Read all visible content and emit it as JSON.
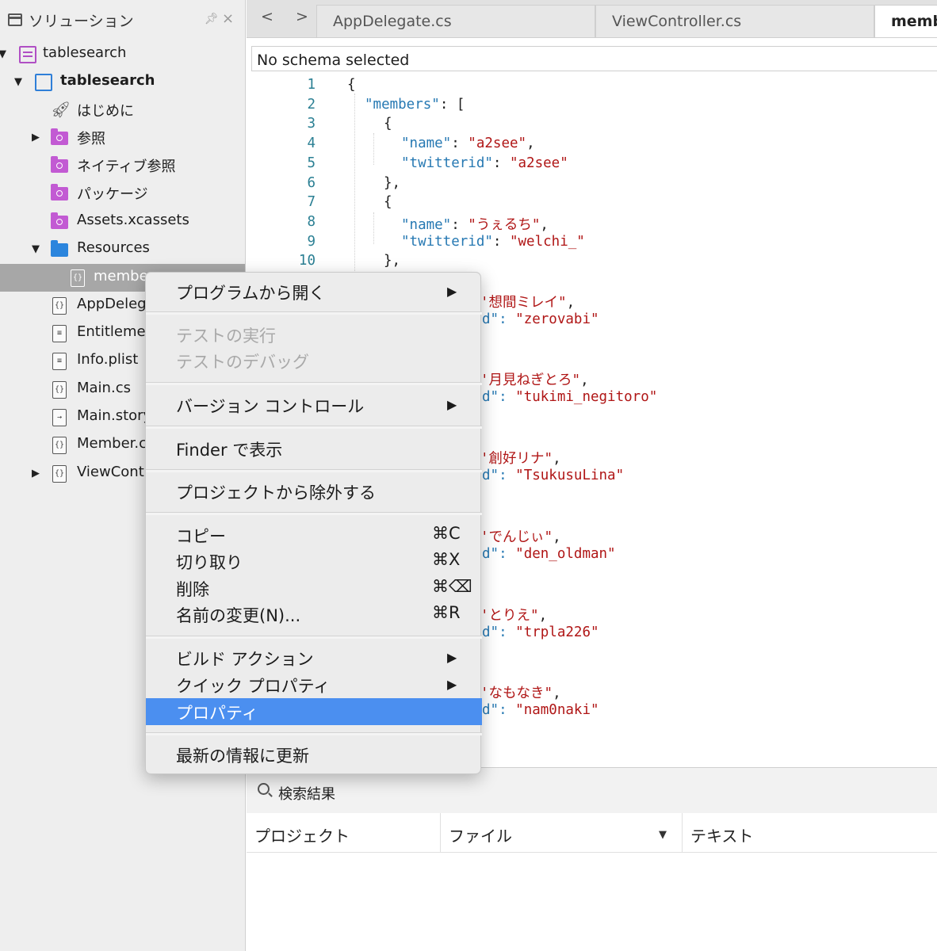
{
  "sidebar": {
    "title": "ソリューション",
    "pin_icon": "pin-icon",
    "close_icon": "close-icon",
    "items": [
      {
        "label": "tablesearch",
        "icon": "solution-icon"
      },
      {
        "label": "tablesearch",
        "icon": "project-icon"
      },
      {
        "label": "はじめに",
        "icon": "rocket-icon"
      },
      {
        "label": "参照",
        "icon": "references-folder-icon"
      },
      {
        "label": "ネイティブ参照",
        "icon": "native-references-folder-icon"
      },
      {
        "label": "パッケージ",
        "icon": "packages-folder-icon"
      },
      {
        "label": "Assets.xcassets",
        "icon": "assets-folder-icon"
      },
      {
        "label": "Resources",
        "icon": "folder-icon"
      },
      {
        "label": "membe",
        "icon": "json-file-icon"
      },
      {
        "label": "AppDeleg",
        "icon": "cs-file-icon"
      },
      {
        "label": "Entitlemer",
        "icon": "plist-file-icon"
      },
      {
        "label": "Info.plist",
        "icon": "plist-file-icon"
      },
      {
        "label": "Main.cs",
        "icon": "cs-file-icon"
      },
      {
        "label": "Main.story",
        "icon": "storyboard-file-icon"
      },
      {
        "label": "Member.c",
        "icon": "cs-file-icon"
      },
      {
        "label": "ViewContr",
        "icon": "cs-file-icon"
      }
    ]
  },
  "editor": {
    "nav_back": "<",
    "nav_forward": ">",
    "tabs": [
      {
        "label": "AppDelegate.cs",
        "active": false
      },
      {
        "label": "ViewController.cs",
        "active": false
      },
      {
        "label": "memb",
        "active": true
      }
    ],
    "schema": "No schema selected",
    "line_numbers": [
      "1",
      "2",
      "3",
      "4",
      "5",
      "6",
      "7",
      "8",
      "9",
      "10"
    ],
    "lines": [
      {
        "text": "{"
      },
      {
        "key": "\"members\"",
        "rest": ": ["
      },
      {
        "text": "{"
      },
      {
        "key": "\"name\"",
        "sep": ": ",
        "str": "\"a2see\"",
        "end": ","
      },
      {
        "key": "\"twitterid\"",
        "sep": ": ",
        "str": "\"a2see\""
      },
      {
        "text": "},"
      },
      {
        "text": "{"
      },
      {
        "key": "\"name\"",
        "sep": ": ",
        "str": "\"うぇるち\"",
        "end": ","
      },
      {
        "key": "\"twitterid\"",
        "sep": ": ",
        "str": "\"welchi_\""
      },
      {
        "text": "},"
      }
    ],
    "hidden_fragments": [
      {
        "prefix": "",
        "str": "'想間ミレイ\"",
        "end": ","
      },
      {
        "prefix": "d\": ",
        "str": "\"zerovabi\""
      },
      {
        "prefix": "",
        "str": "'月見ねぎとろ\"",
        "end": ","
      },
      {
        "prefix": "d\": ",
        "str": "\"tukimi_negitoro\""
      },
      {
        "prefix": "",
        "str": "'創好リナ\"",
        "end": ","
      },
      {
        "prefix": "d\": ",
        "str": "\"TsukusuLina\""
      },
      {
        "prefix": "",
        "str": "'でんじぃ\"",
        "end": ","
      },
      {
        "prefix": "d\": ",
        "str": "\"den_oldman\""
      },
      {
        "prefix": "",
        "str": "'とりえ\"",
        "end": ","
      },
      {
        "prefix": "d\": ",
        "str": "\"trpla226\""
      },
      {
        "prefix": "",
        "str": "'なもなき\"",
        "end": ","
      },
      {
        "prefix": "d\": ",
        "str": "\"nam0naki\""
      }
    ]
  },
  "results": {
    "title": "検索結果",
    "icon": "search-icon",
    "columns": [
      "プロジェクト",
      "ファイル",
      "テキスト"
    ],
    "sort_icon": "▼"
  },
  "context_menu": {
    "items": [
      {
        "label": "プログラムから開く",
        "submenu": true,
        "enabled": true
      },
      {
        "label": "テストの実行",
        "enabled": false
      },
      {
        "label": "テストのデバッグ",
        "enabled": false
      },
      {
        "label": "バージョン コントロール",
        "submenu": true,
        "enabled": true
      },
      {
        "label": "Finder で表示",
        "enabled": true
      },
      {
        "label": "プロジェクトから除外する",
        "enabled": true
      },
      {
        "label": "コピー",
        "shortcut": "⌘C",
        "enabled": true
      },
      {
        "label": "切り取り",
        "shortcut": "⌘X",
        "enabled": true
      },
      {
        "label": "削除",
        "shortcut": "⌘⌫",
        "enabled": true
      },
      {
        "label": "名前の変更(N)...",
        "shortcut": "⌘R",
        "enabled": true
      },
      {
        "label": "ビルド アクション",
        "submenu": true,
        "enabled": true
      },
      {
        "label": "クイック プロパティ",
        "submenu": true,
        "enabled": true
      },
      {
        "label": "プロパティ",
        "enabled": true,
        "highlighted": true
      },
      {
        "label": "最新の情報に更新",
        "enabled": true
      }
    ],
    "submenu_arrow": "▶"
  }
}
